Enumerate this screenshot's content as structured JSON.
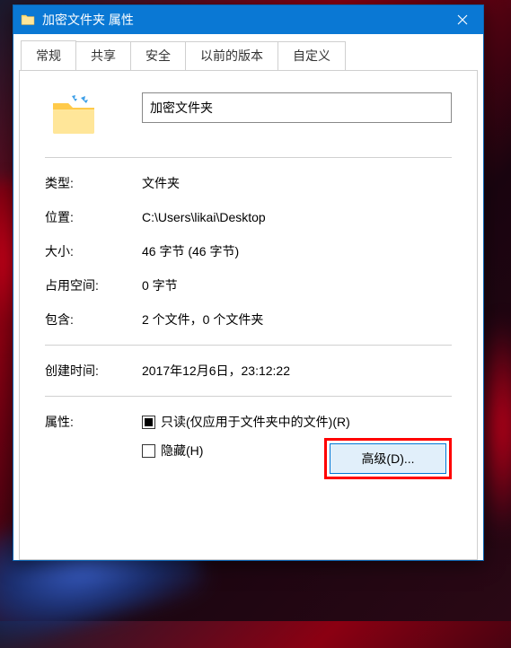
{
  "titlebar": {
    "title": "加密文件夹 属性"
  },
  "tabs": {
    "general": "常规",
    "sharing": "共享",
    "security": "安全",
    "previous": "以前的版本",
    "customize": "自定义"
  },
  "general": {
    "name": "加密文件夹",
    "type_label": "类型:",
    "type_value": "文件夹",
    "location_label": "位置:",
    "location_value": "C:\\Users\\likai\\Desktop",
    "size_label": "大小:",
    "size_value": "46 字节 (46 字节)",
    "size_on_disk_label": "占用空间:",
    "size_on_disk_value": "0 字节",
    "contains_label": "包含:",
    "contains_value": "2 个文件，0 个文件夹",
    "created_label": "创建时间:",
    "created_value": "2017年12月6日，23:12:22",
    "attributes_label": "属性:",
    "readonly_label": "只读(仅应用于文件夹中的文件)(R)",
    "hidden_label": "隐藏(H)",
    "advanced_button": "高级(D)..."
  }
}
